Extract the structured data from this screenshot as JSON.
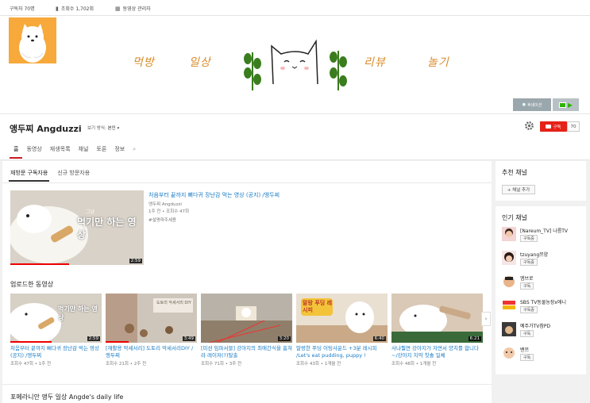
{
  "topbar": {
    "subscribers": "구독자 70명",
    "views": "조회수 1,702회",
    "video_manager": "동영상 관리자"
  },
  "banner": {
    "words": [
      "먹방",
      "일상",
      "리뷰",
      "놀기"
    ],
    "promo_label": "후네이션"
  },
  "channel": {
    "name": "앵두찌 Angduzzi",
    "view_mode_label": "보기 방식:",
    "view_mode_value": "본인",
    "subscribe_label": "구독",
    "subscribe_count": "70"
  },
  "tabs": [
    {
      "label": "홈",
      "active": true
    },
    {
      "label": "동영상",
      "active": false
    },
    {
      "label": "재생목록",
      "active": false
    },
    {
      "label": "채널",
      "active": false
    },
    {
      "label": "토론",
      "active": false
    },
    {
      "label": "정보",
      "active": false
    }
  ],
  "subtabs": [
    {
      "label": "재방문 구독자용",
      "active": true
    },
    {
      "label": "신규 방문자용",
      "active": false
    }
  ],
  "featured": {
    "title": "처음부터 끝까지 뼈다귀 장난감 먹는 영상 (공지) /앵두찌",
    "channel": "앵두찌 Angduzzi",
    "meta": "1주 전 • 조회수 47회",
    "hashtag": "#설명파주세용",
    "duration": "2:59",
    "thumb_text": "먹기만 하는 영상",
    "thumb_small": "그냥"
  },
  "uploads": {
    "heading": "업로드한 동영상",
    "videos": [
      {
        "title": "처음부터 끝까지 뼈다귀 장난감 먹는 영상 (공지) /앵두찌",
        "meta": "조회수 47회 • 1주 전",
        "duration": "2:59",
        "thumb_text": "먹기만 하는 영상",
        "progress": 0.45
      },
      {
        "title": "[재활용 악세서리] 도토리 악세서리DIY /앵두찌",
        "meta": "조회수 21회 • 2주 전",
        "duration": "3:49",
        "thumb_text": "도토리 악세서리 DIY",
        "progress": 0.25
      },
      {
        "title": "[미션 임파서블] 강아지의 최애간식을 훔쳐라 레이저(?)탈출",
        "meta": "조회수 71회 • 3주 전",
        "duration": "3:20",
        "thumb_text": "",
        "progress": 0
      },
      {
        "title": "말랑한 푸딩 이팅사운드 +3분 레시피 /Let's eat pudding, puppy !",
        "meta": "조회수 43회 • 1개월 전",
        "duration": "6:40",
        "thumb_text": "말랑 푸딩 레시피",
        "progress": 0
      },
      {
        "title": "사냐훨면 강아지가 자면서 양치를 합니다~/강아지 치약 칫솔 일체",
        "meta": "조회수 48회 • 1개월 전",
        "duration": "6:21",
        "thumb_text": "",
        "progress": 0
      }
    ]
  },
  "bottom_section": {
    "heading": "포메라니안 앵두 일상 Angde's daily life"
  },
  "sidebar": {
    "recommended_title": "추천 채널",
    "add_channel_label": "+ 채널 추가",
    "popular_title": "인기 채널",
    "subscribe_label": "구독",
    "subscribed_label": "구독중",
    "popular": [
      {
        "name": "[Nareum_TV] 나름TV",
        "button": "구독중"
      },
      {
        "name": "tzuyang쯔양",
        "button": "구독중"
      },
      {
        "name": "엠브로",
        "button": "구독"
      },
      {
        "name": "SBS TV동물농장x애니",
        "button": "구독중"
      },
      {
        "name": "예주가TV참PD",
        "button": "구독"
      },
      {
        "name": "밴쯔",
        "button": "구독"
      }
    ]
  },
  "colors": {
    "link": "#167ac6",
    "red": "#e62117",
    "avatar_bg": "#f7a93b",
    "leaf": "#3a7d1e"
  }
}
